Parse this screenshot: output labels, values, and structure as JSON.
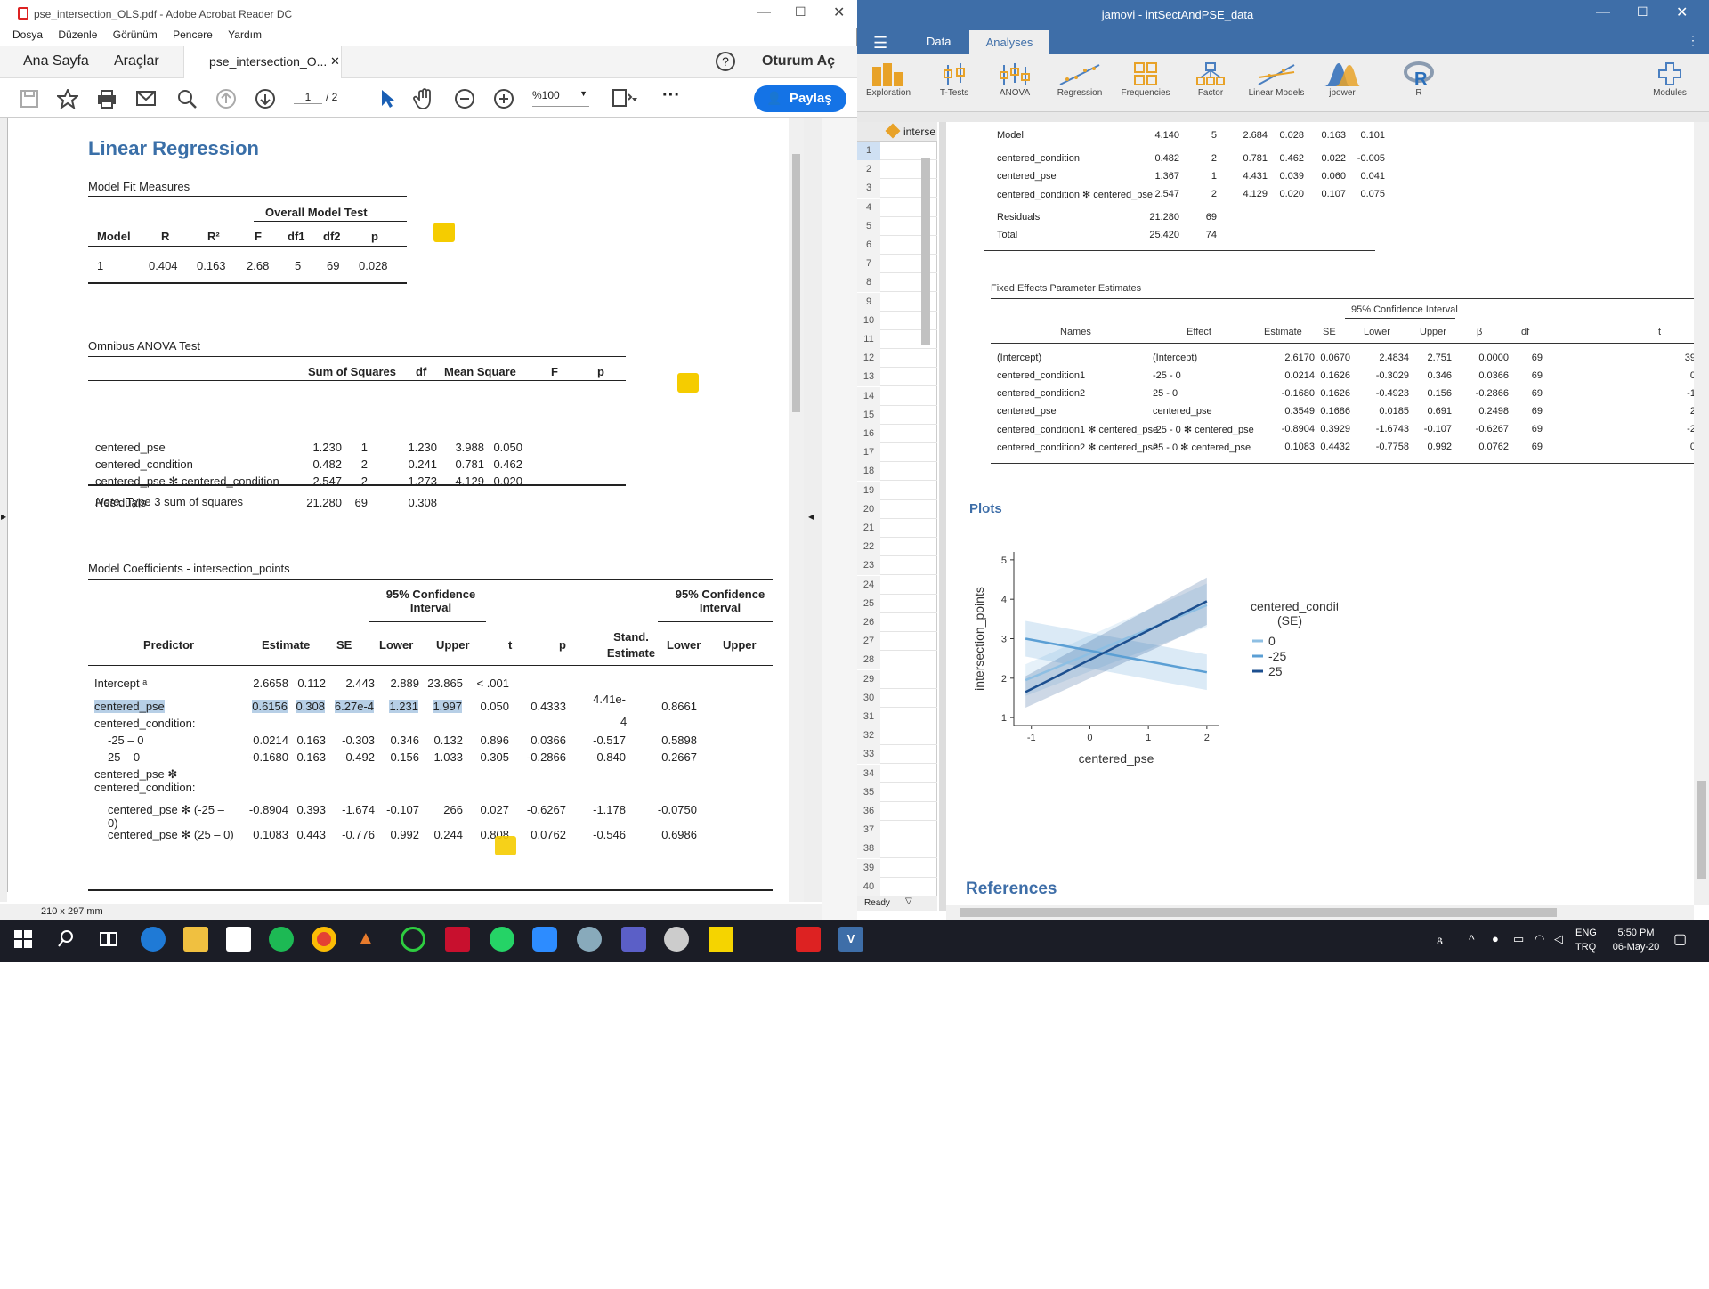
{
  "acrobat": {
    "title": "pse_intersection_OLS.pdf - Adobe Acrobat Reader DC",
    "menu": [
      "Dosya",
      "Düzenle",
      "Görünüm",
      "Pencere",
      "Yardım"
    ],
    "tabs": {
      "home": "Ana Sayfa",
      "tools": "Araçlar",
      "doc": "pse_intersection_O...",
      "signin": "Oturum Aç"
    },
    "page_current": "1",
    "page_total": "/ 2",
    "zoom": "%100",
    "share": "Paylaş",
    "status": "210 x 297 mm"
  },
  "doc": {
    "heading": "Linear Regression",
    "fit": {
      "title": "Model Fit Measures",
      "group": "Overall Model Test",
      "headers": [
        "Model",
        "R",
        "R²",
        "F",
        "df1",
        "df2",
        "p"
      ],
      "row": [
        "1",
        "0.404",
        "0.163",
        "2.68",
        "5",
        "69",
        "0.028"
      ]
    },
    "anova": {
      "title": "Omnibus ANOVA Test",
      "headers": [
        "Sum of Squares",
        "df",
        "Mean Square",
        "F",
        "p"
      ],
      "rows": [
        [
          "centered_pse",
          "1.230",
          "1",
          "1.230",
          "3.988",
          "0.050"
        ],
        [
          "centered_condition",
          "0.482",
          "2",
          "0.241",
          "0.781",
          "0.462"
        ],
        [
          "centered_pse ✻ centered_condition",
          "2.547",
          "2",
          "1.273",
          "4.129",
          "0.020"
        ],
        [
          "Residuals",
          "21.280",
          "69",
          "0.308",
          "",
          ""
        ]
      ],
      "note_label": "Note.",
      "note": "Type 3 sum of squares"
    },
    "coef": {
      "title": "Model Coefficients - intersection_points",
      "ci1": "95% Confidence",
      "ci2": "Interval",
      "headers": [
        "Predictor",
        "Estimate",
        "SE",
        "Lower",
        "Upper",
        "t",
        "p",
        "Stand.",
        "Estimate",
        "Lower",
        "Upper"
      ],
      "rows": [
        [
          "Intercept ᵃ",
          "2.6658",
          "0.112",
          "2.443",
          "2.889",
          "23.865",
          "< .001",
          "",
          "",
          ""
        ],
        [
          "centered_pse",
          "0.6156",
          "0.308",
          "6.27e-4",
          "1.231",
          "1.997",
          "0.050",
          "0.4333",
          "4.41e-",
          "0.8661"
        ],
        [
          "centered_condition:",
          "",
          "",
          "",
          "",
          "",
          "",
          "",
          "",
          ""
        ],
        [
          "-25 – 0",
          "0.0214",
          "0.163",
          "-0.303",
          "0.346",
          "0.132",
          "0.896",
          "0.0366",
          "-0.517",
          "0.5898"
        ],
        [
          "25 – 0",
          "-0.1680",
          "0.163",
          "-0.492",
          "0.156",
          "-1.033",
          "0.305",
          "-0.2866",
          "-0.840",
          "0.2667"
        ],
        [
          "centered_pse ✻",
          "",
          "",
          "",
          "",
          "",
          "",
          "",
          "",
          ""
        ],
        [
          "centered_condition:",
          "",
          "",
          "",
          "",
          "",
          "",
          "",
          "",
          ""
        ],
        [
          "centered_pse ✻ (-25 –",
          "-0.8904",
          "0.393",
          "-1.674",
          "-0.107",
          "266",
          "0.027",
          "-0.6267",
          "-1.178",
          "-0.0750"
        ],
        [
          "0)",
          "",
          "",
          "",
          "",
          "",
          "",
          "",
          "",
          ""
        ],
        [
          "centered_pse ✻ (25 – 0)",
          "0.1083",
          "0.443",
          "-0.776",
          "0.992",
          "0.244",
          "0.808",
          "0.0762",
          "-0.546",
          "0.6986"
        ]
      ],
      "extra4": "4"
    }
  },
  "jamovi": {
    "title": "jamovi - intSectAndPSE_data",
    "tabs": [
      "Data",
      "Analyses"
    ],
    "ribbon": [
      "Exploration",
      "T-Tests",
      "ANOVA",
      "Regression",
      "Frequencies",
      "Factor",
      "Linear Models",
      "jpower",
      "R",
      "Modules"
    ],
    "col_header": "interse",
    "rows": [
      "1",
      "2",
      "3",
      "4",
      "5",
      "6",
      "7",
      "8",
      "9",
      "10",
      "11",
      "12",
      "13",
      "14",
      "15",
      "16",
      "17",
      "18",
      "19",
      "20",
      "21",
      "22",
      "23",
      "24",
      "25",
      "26",
      "27",
      "28",
      "29",
      "30",
      "31",
      "32",
      "33",
      "34",
      "35",
      "36",
      "37",
      "38",
      "39",
      "40"
    ],
    "status": "Ready",
    "anova_rows": [
      [
        "Model",
        "4.140",
        "5",
        "2.684",
        "0.028",
        "0.163",
        "0.101"
      ],
      [
        "centered_condition",
        "0.482",
        "2",
        "0.781",
        "0.462",
        "0.022",
        "-0.005"
      ],
      [
        "centered_pse",
        "1.367",
        "1",
        "4.431",
        "0.039",
        "0.060",
        "0.041"
      ],
      [
        "centered_condition ✻ centered_pse",
        "2.547",
        "2",
        "4.129",
        "0.020",
        "0.107",
        "0.075"
      ],
      [
        "Residuals",
        "21.280",
        "69",
        "",
        "",
        "",
        ""
      ],
      [
        "Total",
        "25.420",
        "74",
        "",
        "",
        "",
        ""
      ]
    ],
    "fixed": {
      "title": "Fixed Effects Parameter Estimates",
      "ci": "95% Confidence Interval",
      "headers": [
        "Names",
        "Effect",
        "Estimate",
        "SE",
        "Lower",
        "Upper",
        "β",
        "df",
        "t"
      ],
      "rows": [
        [
          "(Intercept)",
          "(Intercept)",
          "2.6170",
          "0.0670",
          "2.4834",
          "2.751",
          "0.0000",
          "69",
          "39."
        ],
        [
          "centered_condition1",
          "-25 - 0",
          "0.0214",
          "0.1626",
          "-0.3029",
          "0.346",
          "0.0366",
          "69",
          "0."
        ],
        [
          "centered_condition2",
          "25 - 0",
          "-0.1680",
          "0.1626",
          "-0.4923",
          "0.156",
          "-0.2866",
          "69",
          "-1."
        ],
        [
          "centered_pse",
          "centered_pse",
          "0.3549",
          "0.1686",
          "0.0185",
          "0.691",
          "0.2498",
          "69",
          "2."
        ],
        [
          "centered_condition1 ✻ centered_pse",
          "-25 - 0 ✻ centered_pse",
          "-0.8904",
          "0.3929",
          "-1.6743",
          "-0.107",
          "-0.6267",
          "69",
          "-2."
        ],
        [
          "centered_condition2 ✻ centered_pse",
          "25 - 0 ✻ centered_pse",
          "0.1083",
          "0.4432",
          "-0.7758",
          "0.992",
          "0.0762",
          "69",
          "0."
        ]
      ]
    },
    "plots_heading": "Plots",
    "references_heading": "References"
  },
  "chart_data": {
    "type": "line",
    "xlabel": "centered_pse",
    "ylabel": "intersection_points",
    "xlim": [
      -1.3,
      2.2
    ],
    "ylim": [
      0.8,
      5.2
    ],
    "xticks": [
      "-1",
      "0",
      "1",
      "2"
    ],
    "yticks": [
      "1",
      "2",
      "3",
      "4",
      "5"
    ],
    "legend_title": "centered_condition",
    "legend_subtitle": "(SE)",
    "series": [
      {
        "name": "0",
        "color": "#8ebfe3",
        "x": [
          -1.1,
          2.0
        ],
        "y": [
          1.95,
          3.85
        ],
        "lo": [
          1.55,
          3.3
        ],
        "hi": [
          2.35,
          4.4
        ]
      },
      {
        "name": "-25",
        "color": "#5b9fd4",
        "x": [
          -1.1,
          2.0
        ],
        "y": [
          3.0,
          2.15
        ],
        "lo": [
          2.55,
          1.7
        ],
        "hi": [
          3.45,
          2.6
        ]
      },
      {
        "name": "25",
        "color": "#1c4f8f",
        "x": [
          -1.1,
          2.0
        ],
        "y": [
          1.65,
          3.95
        ],
        "lo": [
          1.25,
          3.35
        ],
        "hi": [
          2.05,
          4.55
        ]
      }
    ],
    "legend": "right"
  },
  "taskbar": {
    "lang": "ENG",
    "layout": "TRQ",
    "time": "5:50 PM",
    "date": "06-May-20"
  }
}
